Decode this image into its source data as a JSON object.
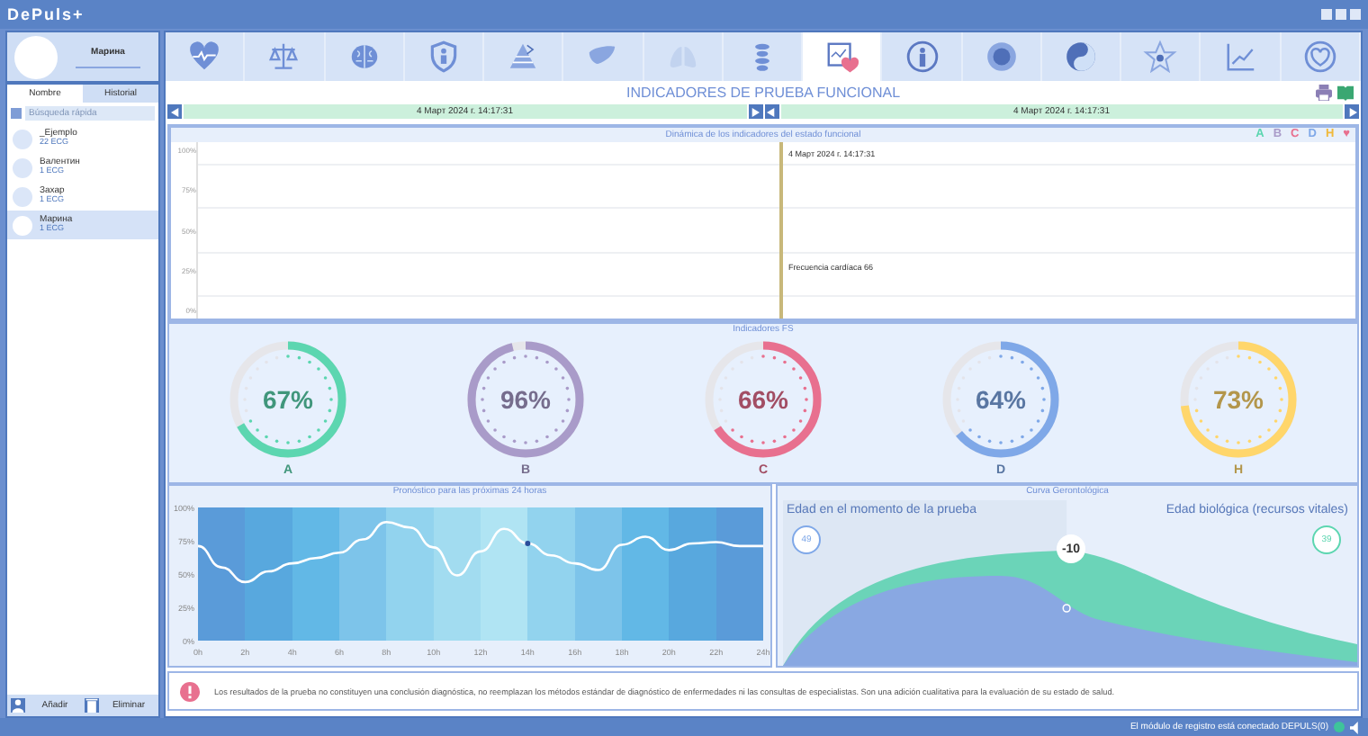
{
  "app": {
    "title": "DePuls+"
  },
  "profile": {
    "name": "Марина"
  },
  "sidebar": {
    "tabs": [
      {
        "label": "Nombre",
        "selected": true
      },
      {
        "label": "Historial",
        "selected": false
      }
    ],
    "search": {
      "placeholder": "Búsqueda rápida"
    },
    "patients": [
      {
        "name": "_Ejemplo",
        "count": "22 ECG",
        "selected": false
      },
      {
        "name": "Валентин",
        "count": "1 ECG",
        "selected": false
      },
      {
        "name": "Захар",
        "count": "1 ECG",
        "selected": false
      },
      {
        "name": "Марина",
        "count": "1 ECG",
        "selected": true
      }
    ],
    "buttons": [
      {
        "kind": "add",
        "label": "Añadir"
      },
      {
        "kind": "delete",
        "label": "Eliminar"
      }
    ]
  },
  "toolbar": [
    {
      "kind": "heart",
      "selected": false
    },
    {
      "kind": "scales",
      "selected": false
    },
    {
      "kind": "brain",
      "selected": false
    },
    {
      "kind": "shield",
      "selected": false
    },
    {
      "kind": "pyramid",
      "selected": false
    },
    {
      "kind": "liver",
      "selected": false
    },
    {
      "kind": "lungs",
      "selected": false
    },
    {
      "kind": "spine",
      "selected": false
    },
    {
      "kind": "report",
      "selected": true
    },
    {
      "kind": "person",
      "selected": false
    },
    {
      "kind": "target",
      "selected": false
    },
    {
      "kind": "yinyang",
      "selected": false
    },
    {
      "kind": "star",
      "selected": false
    },
    {
      "kind": "graph",
      "selected": false
    },
    {
      "kind": "heartring",
      "selected": false
    }
  ],
  "page_title": "INDICADORES DE PRUEBA FUNCIONAL",
  "date_bar": {
    "left": "4 Март 2024 г. 14:17:31",
    "right": "4 Март 2024 г. 14:17:31"
  },
  "dynamics": {
    "title": "Dinámica de los indicadores del estado funcional",
    "legend": [
      {
        "label": "A",
        "color": "#5cd6b0"
      },
      {
        "label": "B",
        "color": "#a99bc9"
      },
      {
        "label": "C",
        "color": "#e8708f"
      },
      {
        "label": "D",
        "color": "#7fa8e8"
      },
      {
        "label": "H",
        "color": "#f0b93a"
      },
      {
        "label": "♥",
        "color": "#e8708f"
      }
    ],
    "y_ticks": [
      "100%",
      "75%",
      "50%",
      "25%",
      "0%"
    ],
    "marker_date": "4 Март 2024 г. 14:17:31",
    "marker_note": "Frecuencia cardíaca 66"
  },
  "indicators": {
    "title": "Indicadores FS",
    "items": [
      {
        "label": "A",
        "value": "67%",
        "level": 0.67,
        "color": "#5cd6b0"
      },
      {
        "label": "B",
        "value": "96%",
        "level": 0.96,
        "color": "#a99bc9"
      },
      {
        "label": "C",
        "value": "66%",
        "level": 0.66,
        "color": "#e8708f"
      },
      {
        "label": "D",
        "value": "64%",
        "level": 0.64,
        "color": "#7fa8e8"
      },
      {
        "label": "H",
        "value": "73%",
        "level": 0.73,
        "color": "#ffd66b"
      }
    ]
  },
  "forecast": {
    "chart_data": {
      "type": "line",
      "title": "Pronóstico para las próximas 24 horas",
      "x": [
        0,
        1,
        2,
        3,
        4,
        5,
        6,
        7,
        8,
        9,
        10,
        11,
        12,
        13,
        14,
        15,
        16,
        17,
        18,
        19,
        20,
        21,
        22,
        23,
        24
      ],
      "series": [
        {
          "color": "#ffffff",
          "values": [
            71,
            55,
            44,
            52,
            58,
            62,
            66,
            76,
            89,
            85,
            70,
            49,
            67,
            84,
            73,
            64,
            58,
            53,
            72,
            78,
            68,
            73,
            74,
            71,
            71
          ]
        }
      ],
      "xlim": [
        0,
        24
      ],
      "ylim": [
        0,
        100
      ],
      "xticks": [
        {
          "value": 0,
          "label": "0h"
        },
        {
          "value": 2,
          "label": "2h"
        },
        {
          "value": 4,
          "label": "4h"
        },
        {
          "value": 6,
          "label": "6h"
        },
        {
          "value": 8,
          "label": "8h"
        },
        {
          "value": 10,
          "label": "10h"
        },
        {
          "value": 12,
          "label": "12h"
        },
        {
          "value": 14,
          "label": "14h"
        },
        {
          "value": 16,
          "label": "16h"
        },
        {
          "value": 18,
          "label": "18h"
        },
        {
          "value": 20,
          "label": "20h"
        },
        {
          "value": 22,
          "label": "22h"
        },
        {
          "value": 24,
          "label": "24h"
        }
      ],
      "yticks": [
        {
          "value": 0,
          "label": "0%"
        },
        {
          "value": 25,
          "label": "25%"
        },
        {
          "value": 50,
          "label": "50%"
        },
        {
          "value": 75,
          "label": "75%"
        },
        {
          "value": 100,
          "label": "100%"
        }
      ]
    }
  },
  "gerontology": {
    "title": "Curva Gerontológica",
    "test_age_label": "Edad en el momento de la prueba",
    "test_age": "49",
    "bio_age_label": "Edad biológica (recursos vitales)",
    "bio_age": "39",
    "difference": "-10"
  },
  "disclaimer": "Los resultados de la prueba no constituyen una conclusión diagnóstica, no reemplazan los métodos estándar de diagnóstico de enfermedades ni las consultas de especialistas. Son una adición cualitativa para la evaluación de su estado de salud.",
  "status_bar": "El módulo de registro está conectado DEPULS(0)"
}
